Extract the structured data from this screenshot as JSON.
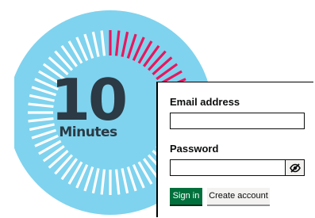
{
  "timer": {
    "number": "10",
    "unit": "Minutes",
    "elapsed_fraction": 0.2,
    "colors": {
      "circle": "#7fd3ee",
      "ticks": "#ffffff",
      "elapsed_ticks": "#e8175d",
      "text": "#2b3a45"
    }
  },
  "login": {
    "email_label": "Email address",
    "email_value": "",
    "password_label": "Password",
    "password_value": "",
    "reveal_icon": "eye-slash-icon",
    "signin_label": "Sign in",
    "create_account_label": "Create account",
    "colors": {
      "signin_bg": "#00703c",
      "secondary_bg": "#f3f2f1"
    }
  }
}
